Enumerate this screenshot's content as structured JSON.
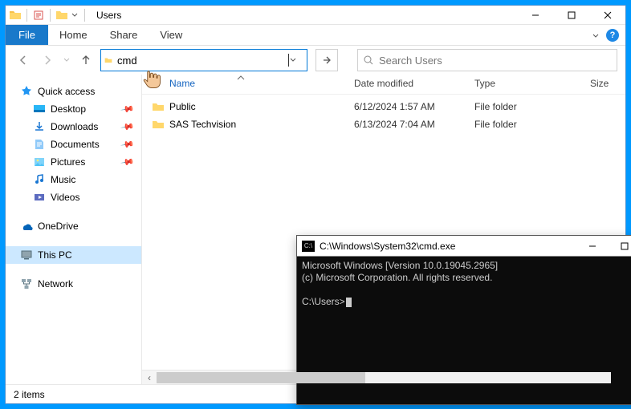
{
  "window": {
    "title": "Users",
    "controls": {
      "minimize": "–",
      "maximize": "□",
      "close": "✕"
    }
  },
  "ribbon": {
    "file": "File",
    "tabs": [
      "Home",
      "Share",
      "View"
    ]
  },
  "nav": {
    "address_value": "cmd",
    "search_placeholder": "Search Users"
  },
  "sidebar": {
    "quick_access": "Quick access",
    "items": [
      {
        "label": "Desktop",
        "pinned": true
      },
      {
        "label": "Downloads",
        "pinned": true
      },
      {
        "label": "Documents",
        "pinned": true
      },
      {
        "label": "Pictures",
        "pinned": true
      },
      {
        "label": "Music",
        "pinned": false
      },
      {
        "label": "Videos",
        "pinned": false
      }
    ],
    "onedrive": "OneDrive",
    "this_pc": "This PC",
    "network": "Network"
  },
  "columns": {
    "name": "Name",
    "date": "Date modified",
    "type": "Type",
    "size": "Size"
  },
  "rows": [
    {
      "name": "Public",
      "date": "6/12/2024 1:57 AM",
      "type": "File folder"
    },
    {
      "name": "SAS Techvision",
      "date": "6/13/2024 7:04 AM",
      "type": "File folder"
    }
  ],
  "status": {
    "count": "2 items"
  },
  "cmd": {
    "title": "C:\\Windows\\System32\\cmd.exe",
    "line1": "Microsoft Windows [Version 10.0.19045.2965]",
    "line2": "(c) Microsoft Corporation. All rights reserved.",
    "prompt": "C:\\Users>"
  }
}
